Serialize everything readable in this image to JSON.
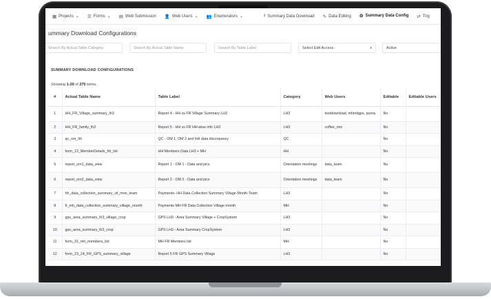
{
  "nav": [
    {
      "icon": "grid-icon",
      "glyph": "▦",
      "label": "Projects",
      "caret": "⌄"
    },
    {
      "icon": "forms-icon",
      "glyph": "☰",
      "label": "Forms",
      "caret": "⌄"
    },
    {
      "icon": "database-icon",
      "glyph": "▤",
      "label": "Web Submission",
      "caret": ""
    },
    {
      "icon": "user-icon",
      "glyph": "👤",
      "label": "Web Users",
      "caret": "⌄"
    },
    {
      "icon": "users-icon",
      "glyph": "👥",
      "label": "Enumerators",
      "caret": "⌄"
    },
    {
      "icon": "download-icon",
      "glyph": "⭳",
      "label": "Summary Data Download",
      "caret": ""
    },
    {
      "icon": "edit-icon",
      "glyph": "✎",
      "label": "Data Editing",
      "caret": ""
    },
    {
      "icon": "gear-icon",
      "glyph": "⚙",
      "label": "Summary Data Config",
      "caret": ""
    },
    {
      "icon": "refresh-icon",
      "glyph": "⇄",
      "label": "Trig",
      "caret": ""
    }
  ],
  "page_title": "ummary Download Configurations",
  "filters": {
    "category_placeholder": "Search By Actual Table Category",
    "name_placeholder": "Search By Actual Table Name",
    "label_placeholder": "Search By Table Label",
    "edit_access": "Select Edit Access",
    "status": "Active"
  },
  "section_heading": "SUMMARY DOWNLOAD CONFIGURATIONS",
  "summary": {
    "prefix": "Showing ",
    "range": "1-20",
    "middle": " of ",
    "total": "275",
    "suffix": " items."
  },
  "table": {
    "headers": [
      "#",
      "Actual Table Name",
      "Table Label",
      "Category",
      "Web Users",
      "Editable",
      "Editable Users"
    ],
    "rows": [
      [
        "1",
        "HH_FR_Village_summary_lh3",
        "Report 4 - HH vs FR Village Summary LH3",
        "LH3",
        "testdownload, mhindgps, purna",
        "No",
        ""
      ],
      [
        "2",
        "HH_FR_family_lh3",
        "Report 5 - HH vs FR HH-wise info LH3",
        "LH3",
        "coffee_mis",
        "No",
        ""
      ],
      [
        "3",
        "qc_om_hh",
        "QC - OM 1, OM 2 and HH data discrepancy",
        "QC",
        "",
        "No",
        ""
      ],
      [
        "4",
        "form_12_MemberDetails_hh_list",
        "HH Members Data LH3 + MH",
        "HH",
        "",
        "No",
        ""
      ],
      [
        "5",
        "report_om1_data_view",
        "Report 1 - OM 1 - Data and pics",
        "Orientation meetings",
        "data_team",
        "No",
        ""
      ],
      [
        "6",
        "report_om2_data_view",
        "Report 2 - OM 2 - Data and pics",
        "Orientation meetings",
        "data_team",
        "No",
        ""
      ],
      [
        "7",
        "hh_data_collection_summary_vil_mon_team",
        "Payments- HH Data Collection Summary Village-Month-Team",
        "LH3",
        "",
        "No",
        ""
      ],
      [
        "8",
        "fr_mh_data_collection_summary_village_month",
        "Payments MH FR Data Collection Village month",
        "MH",
        "",
        "No",
        ""
      ],
      [
        "9",
        "gps_area_summary_lh3_village_crop",
        "GPS LH3 - Area Summary Village + CropSystem",
        "LH3",
        "",
        "No",
        ""
      ],
      [
        "10",
        "gps_area_summary_lh3_crop",
        "GPS LH3 - Area Summary CropSystem",
        "LH3",
        "",
        "No",
        ""
      ],
      [
        "11",
        "form_31_mh_members_list",
        "MH FR Members list",
        "MH",
        "",
        "No",
        ""
      ],
      [
        "12",
        "form_23_24_FR_GPS_summary_village",
        "Report 5 FR GPS Summary Village",
        "LH3",
        "",
        "No",
        ""
      ]
    ]
  }
}
